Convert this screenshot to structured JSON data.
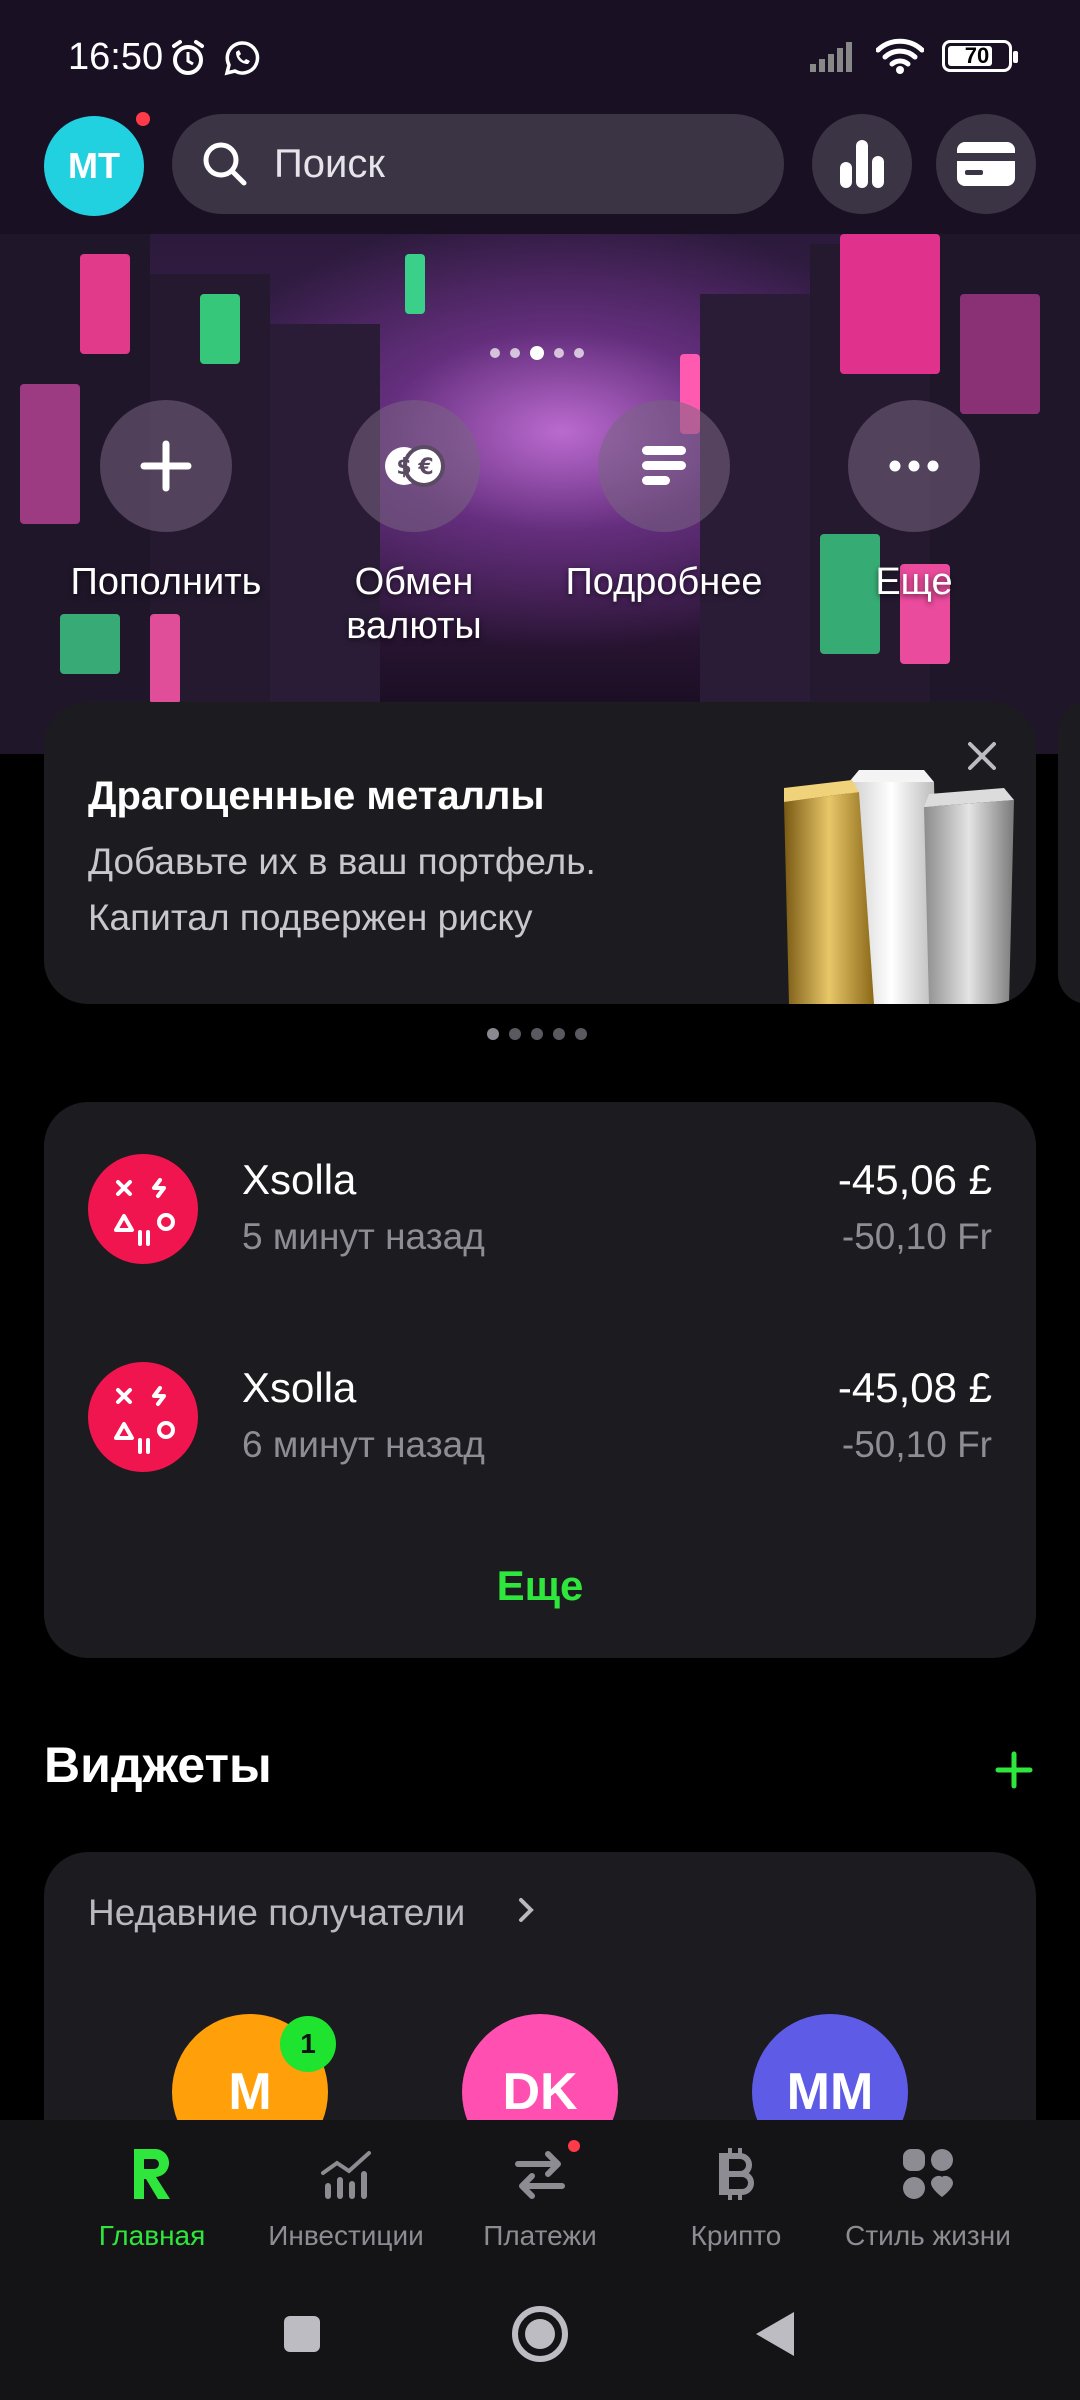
{
  "status_bar": {
    "time": "16:50",
    "battery": "70"
  },
  "header": {
    "avatar_initials": "MT",
    "search_placeholder": "Поиск"
  },
  "hero": {
    "actions": [
      {
        "label": "Пополнить",
        "icon": "plus-icon"
      },
      {
        "label": "Обмен валюты",
        "icon": "currency-exchange-icon"
      },
      {
        "label": "Подробнее",
        "icon": "details-icon"
      },
      {
        "label": "Еще",
        "icon": "more-icon"
      }
    ]
  },
  "promo": {
    "title": "Драгоценные металлы",
    "text": "Добавьте их в ваш портфель. Капитал подвержен риску"
  },
  "transactions": {
    "items": [
      {
        "merchant": "Xsolla",
        "time": "5 минут назад",
        "amount": "-45,06 £",
        "amount_secondary": "-50,10 Fr"
      },
      {
        "merchant": "Xsolla",
        "time": "6 минут назад",
        "amount": "-45,08 £",
        "amount_secondary": "-50,10 Fr"
      }
    ],
    "more_label": "Еще"
  },
  "widgets": {
    "title": "Виджеты",
    "recent_recipients": {
      "title": "Недавние получатели",
      "people": [
        {
          "initials": "M",
          "color": "#ff9f0a",
          "badge": "1"
        },
        {
          "initials": "DK",
          "color": "#ff4fb0"
        },
        {
          "initials": "MM",
          "color": "#5e5ce6"
        }
      ]
    }
  },
  "bottom_nav": {
    "items": [
      {
        "label": "Главная",
        "active": true
      },
      {
        "label": "Инвестиции"
      },
      {
        "label": "Платежи"
      },
      {
        "label": "Крипто"
      },
      {
        "label": "Стиль жизни"
      }
    ]
  },
  "colors": {
    "accent": "#2ee63c",
    "merchant_icon": "#f0154f",
    "avatar": "#22d1e0"
  }
}
